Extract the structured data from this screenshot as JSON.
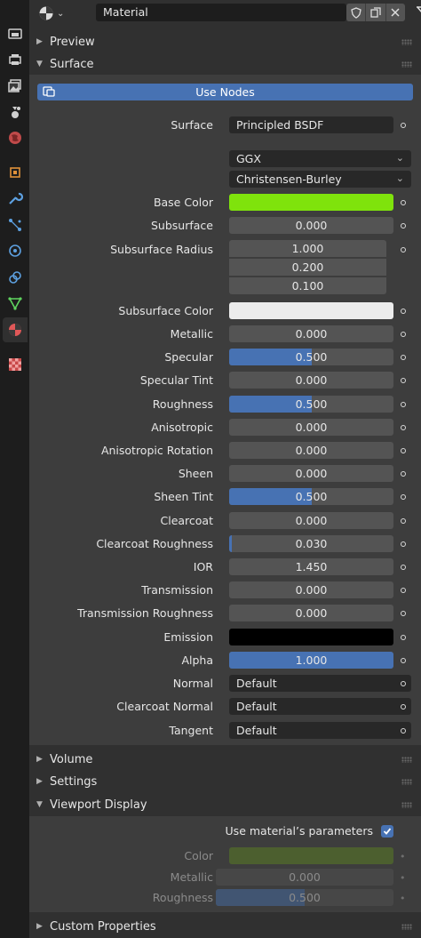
{
  "header": {
    "material_name": "Material"
  },
  "panels": {
    "preview": "Preview",
    "surface": "Surface",
    "volume": "Volume",
    "settings": "Settings",
    "viewport_display": "Viewport Display",
    "custom_properties": "Custom Properties"
  },
  "surface": {
    "use_nodes_label": "Use Nodes",
    "surface_label": "Surface",
    "surface_value": "Principled BSDF",
    "distribution": "GGX",
    "subsurface_method": "Christensen-Burley",
    "base_color_label": "Base Color",
    "base_color": "#7fe30c",
    "subsurface_label": "Subsurface",
    "subsurface_value": "0.000",
    "subsurface_radius_label": "Subsurface Radius",
    "subsurface_radius": [
      "1.000",
      "0.200",
      "0.100"
    ],
    "subsurface_color_label": "Subsurface Color",
    "subsurface_color": "#ececec",
    "emission_label": "Emission",
    "emission_color": "#000000",
    "props": [
      {
        "label": "Metallic",
        "value": "0.000",
        "fill": 0.0
      },
      {
        "label": "Specular",
        "value": "0.500",
        "fill": 0.5
      },
      {
        "label": "Specular Tint",
        "value": "0.000",
        "fill": 0.0
      },
      {
        "label": "Roughness",
        "value": "0.500",
        "fill": 0.5
      },
      {
        "label": "Anisotropic",
        "value": "0.000",
        "fill": 0.0
      },
      {
        "label": "Anisotropic Rotation",
        "value": "0.000",
        "fill": 0.0
      },
      {
        "label": "Sheen",
        "value": "0.000",
        "fill": 0.0
      },
      {
        "label": "Sheen Tint",
        "value": "0.500",
        "fill": 0.5
      },
      {
        "label": "Clearcoat",
        "value": "0.000",
        "fill": 0.0
      },
      {
        "label": "Clearcoat Roughness",
        "value": "0.030",
        "fill": 0.03
      },
      {
        "label": "IOR",
        "value": "1.450",
        "fill": 0.0
      },
      {
        "label": "Transmission",
        "value": "0.000",
        "fill": 0.0
      },
      {
        "label": "Transmission Roughness",
        "value": "0.000",
        "fill": 0.0
      }
    ],
    "alpha_label": "Alpha",
    "alpha_value": "1.000",
    "alpha_fill": 1.0,
    "normal_label": "Normal",
    "normal_value": "Default",
    "clearcoat_normal_label": "Clearcoat Normal",
    "clearcoat_normal_value": "Default",
    "tangent_label": "Tangent",
    "tangent_value": "Default"
  },
  "viewport": {
    "use_material_params_label": "Use material’s parameters",
    "use_material_params_checked": true,
    "color_label": "Color",
    "color": "#5f8a1f",
    "metallic_label": "Metallic",
    "metallic_value": "0.000",
    "roughness_label": "Roughness",
    "roughness_value": "0.500",
    "roughness_fill": 0.5
  },
  "colors": {
    "accent": "#4772b3",
    "background": "#303030",
    "panel": "#3d3d3d",
    "field": "#545454"
  }
}
